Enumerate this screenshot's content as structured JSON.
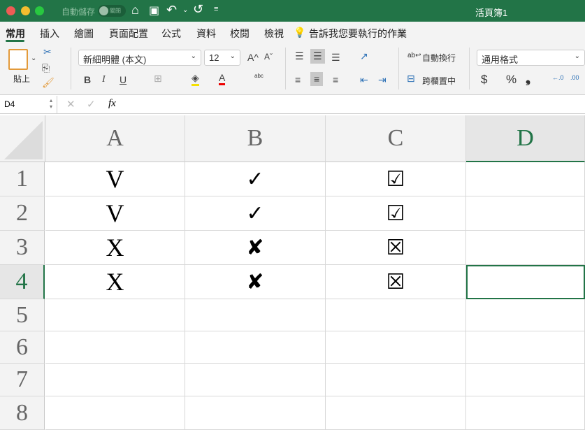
{
  "titlebar": {
    "autosave_label": "自動儲存",
    "autosave_state": "關閉",
    "title": "活頁簿1"
  },
  "tabs": [
    "常用",
    "插入",
    "繪圖",
    "頁面配置",
    "公式",
    "資料",
    "校閱",
    "檢視"
  ],
  "tell_me": "告訴我您要執行的作業",
  "ribbon": {
    "paste": "貼上",
    "font": "新細明體 (本文)",
    "size": "12",
    "wrap": "自動換行",
    "merge": "跨欄置中",
    "number_format": "通用格式",
    "bold": "B",
    "italic": "I",
    "underline": "U",
    "grow": "A^",
    "shrink": "Aˇ",
    "currency": "$",
    "percent": "%",
    "comma": "❟",
    "font_color": "A",
    "phonetic": "abc"
  },
  "formula_bar": {
    "name_box": "D4",
    "fx": "fx",
    "content": ""
  },
  "columns": [
    "A",
    "B",
    "C",
    "D"
  ],
  "rows": [
    "1",
    "2",
    "3",
    "4",
    "5",
    "6",
    "7",
    "8"
  ],
  "cells": [
    [
      "V",
      "✓",
      "☑",
      ""
    ],
    [
      "V",
      "✓",
      "☑",
      ""
    ],
    [
      "X",
      "✘",
      "☒",
      ""
    ],
    [
      "X",
      "✘",
      "☒",
      ""
    ]
  ],
  "selected_cell": "D4",
  "colors": {
    "accent": "#227447"
  }
}
